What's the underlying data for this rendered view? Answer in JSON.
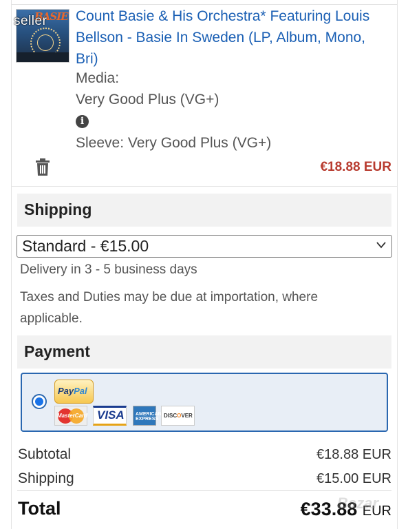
{
  "item": {
    "title": "Count Basie & His Orchestra* Featuring Louis Bellson - Basie In Sweden (LP, Album, Mono, Bri)",
    "thumbnail_text": "BASIE",
    "seller_mark": "seller",
    "media_label": "Media:",
    "media_value": "Very Good Plus (VG+)",
    "info_icon": "i",
    "sleeve": "Sleeve: Very Good Plus (VG+)",
    "price": "€18.88 EUR",
    "price_color": "#b83b2f",
    "remove_icon": "trash-icon"
  },
  "shipping": {
    "heading": "Shipping",
    "selected_option": "Standard - €15.00",
    "delivery": "Delivery in 3 - 5 business days",
    "taxes_note": "Taxes and Duties may be due at importation, where applicable."
  },
  "payment": {
    "heading": "Payment",
    "selected": true,
    "methods": {
      "paypal_a": "Pay",
      "paypal_b": "Pal",
      "mastercard": "MasterCard",
      "visa": "VISA",
      "amex": "AMERICAN EXPRESS",
      "discover_a": "DISC",
      "discover_b": "O",
      "discover_c": "VER"
    },
    "accent_color": "#2a67b0"
  },
  "totals": {
    "subtotal_label": "Subtotal",
    "subtotal_value": "€18.88 EUR",
    "shipping_label": "Shipping",
    "shipping_value": "€15.00 EUR",
    "total_label": "Total",
    "total_amount": "€33.88",
    "total_currency": "EUR"
  },
  "watermark": "Bazar"
}
